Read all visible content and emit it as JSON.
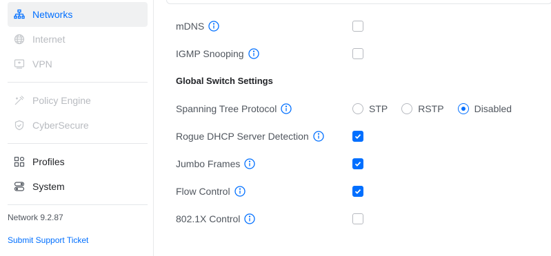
{
  "sidebar": {
    "items": [
      {
        "label": "Networks",
        "icon": "networks-icon"
      },
      {
        "label": "Internet",
        "icon": "globe-icon"
      },
      {
        "label": "VPN",
        "icon": "vpn-icon"
      },
      {
        "label": "Policy Engine",
        "icon": "policy-engine-icon"
      },
      {
        "label": "CyberSecure",
        "icon": "shield-icon"
      },
      {
        "label": "Profiles",
        "icon": "profiles-icon"
      },
      {
        "label": "System",
        "icon": "system-icon"
      }
    ],
    "version": "Network 9.2.87",
    "support_link": "Submit Support Ticket"
  },
  "settings": {
    "mdns": {
      "label": "mDNS",
      "checked": false
    },
    "igmp": {
      "label": "IGMP Snooping",
      "checked": false
    },
    "section_title": "Global Switch Settings",
    "stp": {
      "label": "Spanning Tree Protocol",
      "options": [
        "STP",
        "RSTP",
        "Disabled"
      ],
      "selected": "Disabled"
    },
    "rogue_dhcp": {
      "label": "Rogue DHCP Server Detection",
      "checked": true
    },
    "jumbo": {
      "label": "Jumbo Frames",
      "checked": true
    },
    "flow": {
      "label": "Flow Control",
      "checked": true
    },
    "dot1x": {
      "label": "802.1X Control",
      "checked": false
    }
  },
  "colors": {
    "accent": "#006fff",
    "disabled_text": "#b8bbc0",
    "text": "#50565e"
  }
}
